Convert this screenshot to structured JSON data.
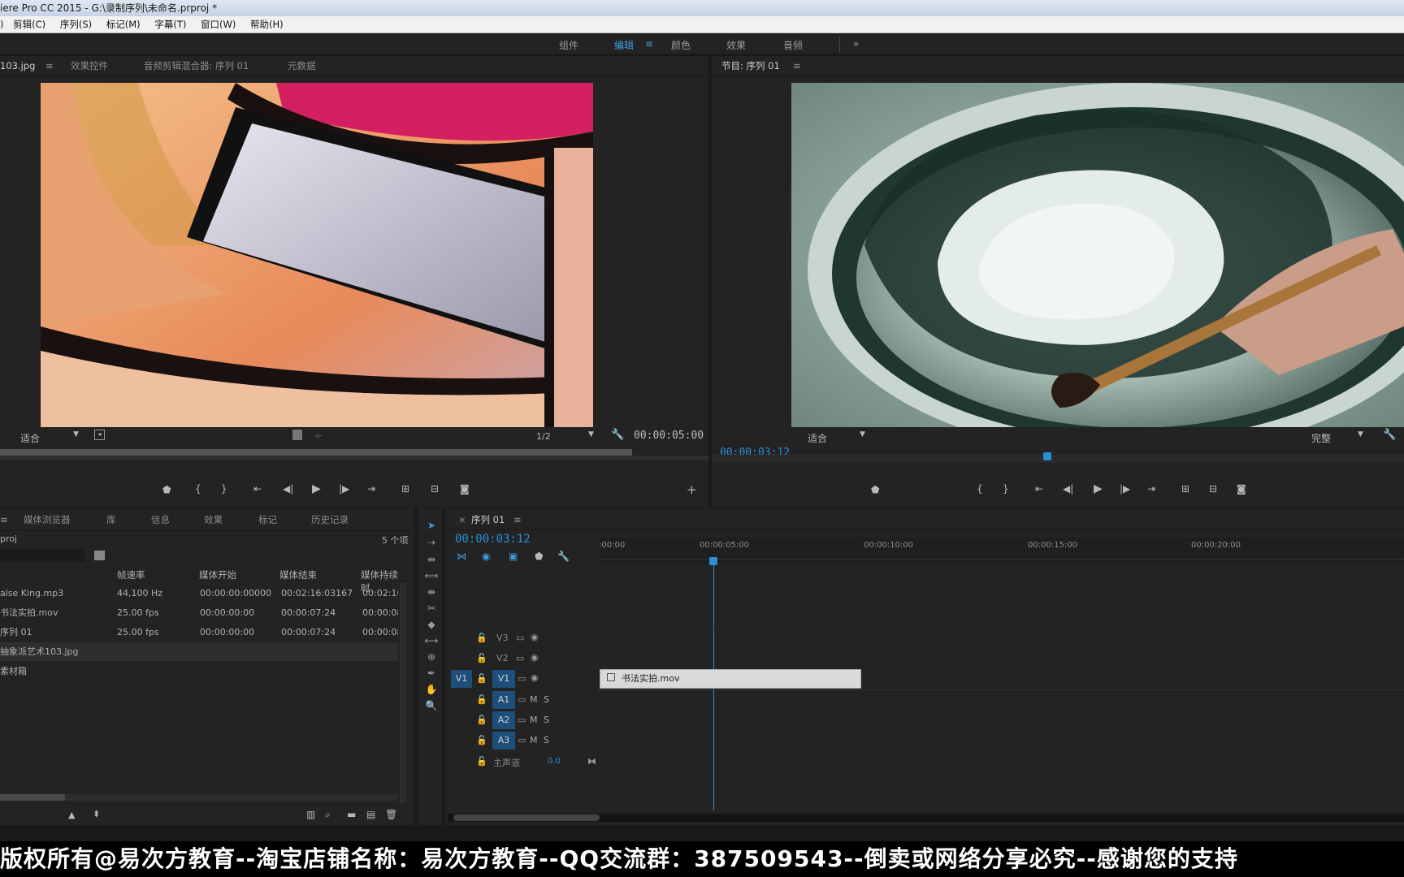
{
  "title": "iere Pro CC 2015 - G:\\录制序列\\未命名.prproj *",
  "menu": [
    "剪辑(C)",
    "序列(S)",
    "标记(M)",
    "字幕(T)",
    "窗口(W)",
    "帮助(H)"
  ],
  "workspaces": [
    "组件",
    "编辑",
    "颜色",
    "效果",
    "音频"
  ],
  "workspace_more": "»",
  "source": {
    "tabs": [
      "103.jpg",
      "效果控件",
      "音频剪辑混合器: 序列 01",
      "元数据"
    ],
    "fit": "适合",
    "resolution": "1/2",
    "duration": "00:00:05:00"
  },
  "program": {
    "tab": "节目: 序列 01",
    "timecode": "00:00:03:12",
    "fit": "适合",
    "quality": "完整"
  },
  "project": {
    "tabs": [
      "媒体浏览器",
      "库",
      "信息",
      "效果",
      "标记",
      "历史记录"
    ],
    "name": "proj",
    "count": "5 个项",
    "columns": [
      "帧速率",
      "媒体开始",
      "媒体结束",
      "媒体持续时"
    ],
    "rows": [
      {
        "name": "alse King.mp3",
        "fps": "44,100 Hz",
        "start": "00:00:00:00000",
        "end": "00:02:16:03167",
        "dur": "00:02:16"
      },
      {
        "name": "书法实拍.mov",
        "fps": "25.00 fps",
        "start": "00:00:00:00",
        "end": "00:00:07:24",
        "dur": "00:00:08"
      },
      {
        "name": "序列 01",
        "fps": "25.00 fps",
        "start": "00:00:00:00",
        "end": "00:00:07:24",
        "dur": "00:00:08"
      },
      {
        "name": "抽象派艺术103.jpg",
        "fps": "",
        "start": "",
        "end": "",
        "dur": ""
      },
      {
        "name": "素材箱",
        "fps": "",
        "start": "",
        "end": "",
        "dur": ""
      }
    ]
  },
  "timeline": {
    "tab": "序列 01",
    "timecode": "00:00:03:12",
    "ruler": [
      ":00:00",
      "00:00:05:00",
      "00:00:10:00",
      "00:00:15:00",
      "00:00:20:00"
    ],
    "tracks": {
      "v3": "V3",
      "v2": "V2",
      "v1": "V1",
      "src_v1": "V1",
      "a1": "A1",
      "a2": "A2",
      "a3": "A3",
      "master": "主声道",
      "master_val": "0.0",
      "m": "M",
      "s": "S"
    },
    "clip": "书法实拍.mov"
  },
  "watermark": "版权所有@易次方教育--淘宝店铺名称：易次方教育--QQ交流群：387509543--倒卖或网络分享必究--感谢您的支持"
}
